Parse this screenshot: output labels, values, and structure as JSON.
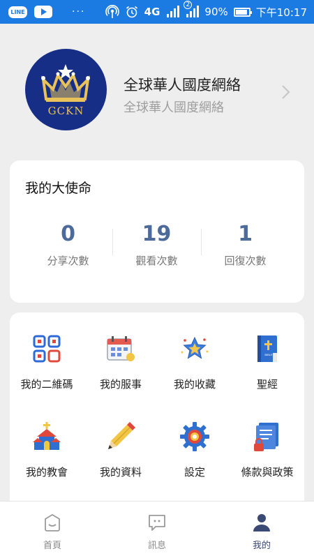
{
  "statusbar": {
    "line_label": "LINE",
    "dots": "···",
    "network": "4G",
    "sim2": "2",
    "battery": "90%",
    "time": "下午10:17"
  },
  "profile": {
    "logo_text": "GCKN",
    "name": "全球華人國度網絡",
    "subtitle": "全球華人國度網絡"
  },
  "mission": {
    "title": "我的大使命",
    "stats": [
      {
        "value": "0",
        "label": "分享次數"
      },
      {
        "value": "19",
        "label": "觀看次數"
      },
      {
        "value": "1",
        "label": "回復次數"
      }
    ]
  },
  "grid": {
    "items": [
      {
        "label": "我的二維碼",
        "icon": "qr-code-icon"
      },
      {
        "label": "我的服事",
        "icon": "calendar-icon"
      },
      {
        "label": "我的收藏",
        "icon": "star-icon"
      },
      {
        "label": "聖經",
        "icon": "bible-icon"
      },
      {
        "label": "我的教會",
        "icon": "church-icon"
      },
      {
        "label": "我的資料",
        "icon": "pencil-icon"
      },
      {
        "label": "設定",
        "icon": "gear-icon"
      },
      {
        "label": "條款與政策",
        "icon": "document-lock-icon"
      }
    ]
  },
  "bottomnav": {
    "items": [
      {
        "label": "首頁",
        "icon": "home-icon"
      },
      {
        "label": "訊息",
        "icon": "message-icon"
      },
      {
        "label": "我的",
        "icon": "user-icon"
      }
    ],
    "active": "我的"
  },
  "colors": {
    "statusbar": "#1c7be3",
    "avatar_bg": "#162e86",
    "stat_number": "#4c6a9a",
    "nav_active": "#3a4a74"
  }
}
